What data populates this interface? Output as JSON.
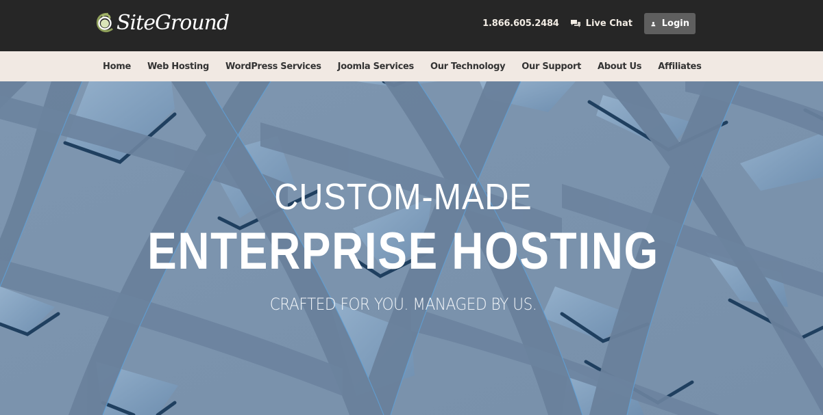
{
  "header": {
    "brand": "SiteGround",
    "logo_icon": "siteground-swirl-icon",
    "phone": "1.866.605.2484",
    "live_chat": {
      "label": "Live Chat",
      "icon": "chat-bubbles-icon"
    },
    "login": {
      "label": "Login",
      "icon": "user-icon"
    }
  },
  "nav": {
    "items": [
      {
        "label": "Home"
      },
      {
        "label": "Web Hosting"
      },
      {
        "label": "WordPress Services"
      },
      {
        "label": "Joomla Services"
      },
      {
        "label": "Our Technology"
      },
      {
        "label": "Our Support"
      },
      {
        "label": "About Us"
      },
      {
        "label": "Affiliates"
      }
    ]
  },
  "hero": {
    "line1": "CUSTOM-MADE",
    "line2": "ENTERPRISE HOSTING",
    "subtitle": "CRAFTED FOR YOU. MANAGED BY US."
  },
  "colors": {
    "topbar_bg": "#262626",
    "navbar_bg": "#f1e9e3",
    "login_bg": "#5f5f5f",
    "brand_green": "#a3b46a",
    "hero_bg": "#7b93ad"
  }
}
